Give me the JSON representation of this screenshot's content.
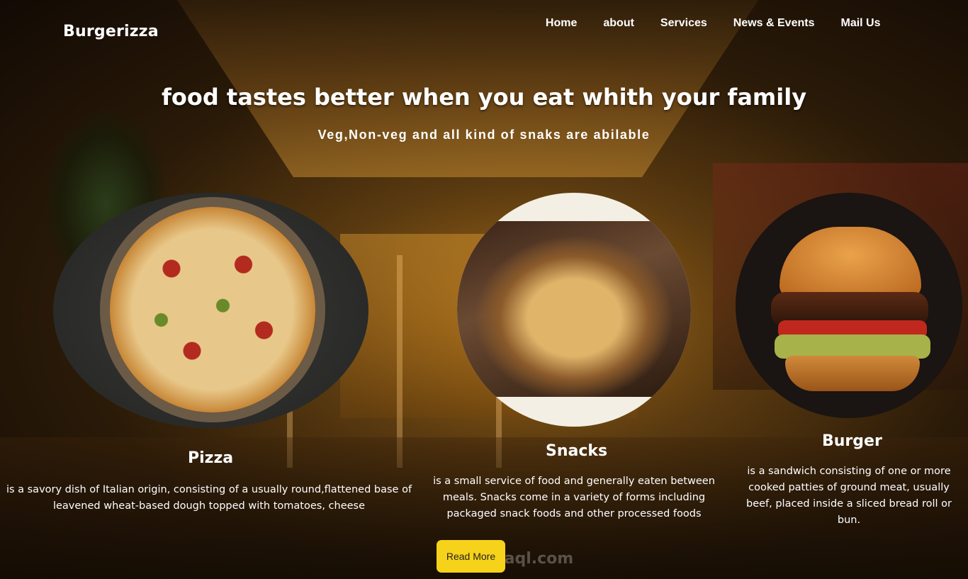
{
  "header": {
    "brand": "Burgerizza",
    "nav": [
      "Home",
      "about",
      "Services",
      "News & Events",
      "Mail Us"
    ]
  },
  "hero": {
    "title": "food tastes better when you eat whith your family",
    "subtitle": "Veg,Non-veg and all kind of snaks are abilable"
  },
  "cards": [
    {
      "title": "Pizza",
      "description": "is a savory dish of Italian origin, consisting of a usually round,flattened base of leavened wheat-based dough topped with tomatoes, cheese"
    },
    {
      "title": "Snacks",
      "description": "is a small service of food and generally eaten between meals. Snacks come in a variety of forms including packaged snack foods and other processed foods"
    },
    {
      "title": "Burger",
      "description": "is a sandwich consisting of one or more cooked patties of ground meat, usually beef, placed inside a sliced bread roll or bun."
    }
  ],
  "read_more": "Read More",
  "watermark": "mostaql.com"
}
